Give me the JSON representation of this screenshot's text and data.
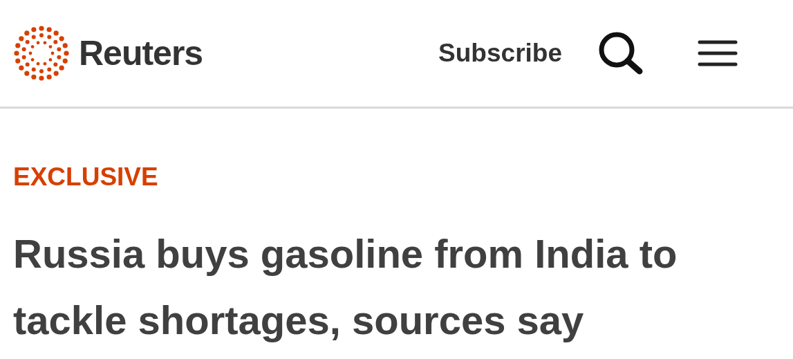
{
  "header": {
    "brand": "Reuters",
    "subscribe": "Subscribe"
  },
  "article": {
    "label": "EXCLUSIVE",
    "headline": "Russia buys gasoline from India to tackle shortages, sources say"
  }
}
